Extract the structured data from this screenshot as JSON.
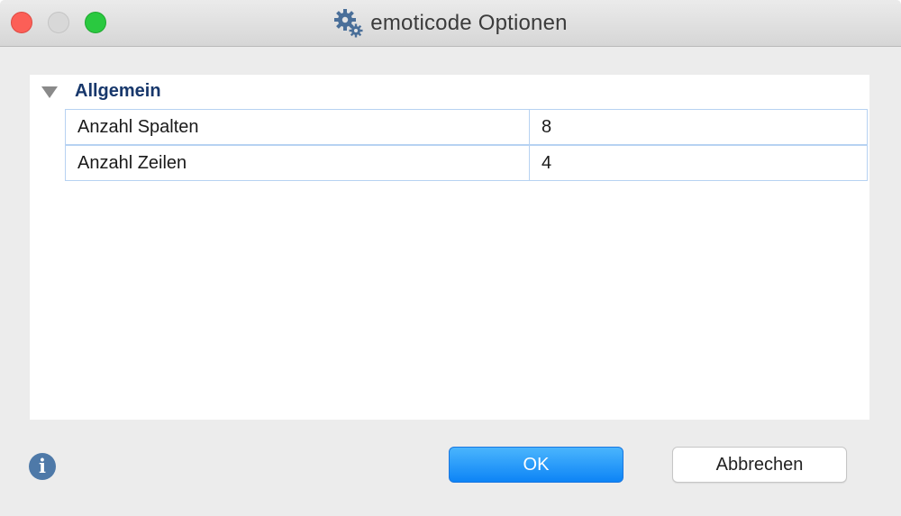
{
  "window": {
    "title": "emoticode Optionen",
    "title_icon": "gears-icon"
  },
  "traffic_lights": {
    "close": "#fc5f57",
    "minimize": "#d8d8d8",
    "zoom": "#2ac940"
  },
  "properties": {
    "group_label": "Allgemein",
    "group_label_color": "#17376b",
    "rows": [
      {
        "name": "Anzahl Spalten",
        "value": "8"
      },
      {
        "name": "Anzahl Zeilen",
        "value": "4"
      }
    ]
  },
  "footer": {
    "info_icon": "info-icon",
    "info_glyph": "i",
    "ok_label": "OK",
    "cancel_label": "Abbrechen",
    "accent": "#0d84f6"
  }
}
